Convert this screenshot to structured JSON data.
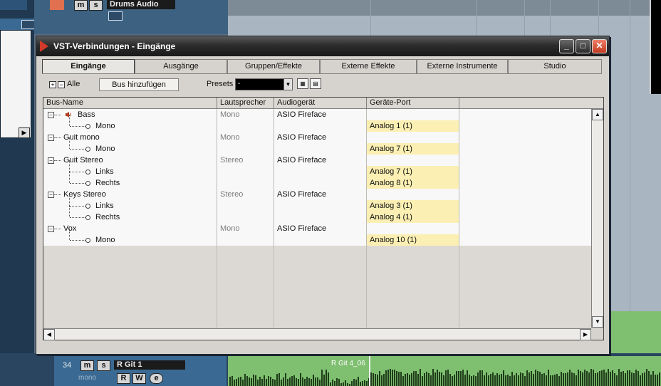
{
  "window": {
    "title": "VST-Verbindungen - Eingänge",
    "minimize_label": "_",
    "maximize_label": "□",
    "close_label": "✕"
  },
  "tabs": [
    {
      "label": "Eingänge",
      "active": true
    },
    {
      "label": "Ausgänge"
    },
    {
      "label": "Gruppen/Effekte"
    },
    {
      "label": "Externe Effekte"
    },
    {
      "label": "Externe Instrumente"
    },
    {
      "label": "Studio"
    }
  ],
  "toolbar": {
    "all_label": "Alle",
    "add_bus_label": "Bus hinzufügen",
    "presets_label": "Presets",
    "presets_value": "-"
  },
  "table": {
    "columns": [
      "Bus-Name",
      "Lautsprecher",
      "Audiogerät",
      "Geräte-Port"
    ],
    "rows": [
      {
        "name": "Bass",
        "speaker": "Mono",
        "device": "ASIO Fireface",
        "port": "",
        "level": 0
      },
      {
        "name": "Mono",
        "speaker": "",
        "device": "",
        "port": "Analog 1 (1)",
        "level": 1
      },
      {
        "name": "Guit mono",
        "speaker": "Mono",
        "device": "ASIO Fireface",
        "port": "",
        "level": 0
      },
      {
        "name": "Mono",
        "speaker": "",
        "device": "",
        "port": "Analog 7 (1)",
        "level": 1
      },
      {
        "name": "Guit Stereo",
        "speaker": "Stereo",
        "device": "ASIO Fireface",
        "port": "",
        "level": 0
      },
      {
        "name": "Links",
        "speaker": "",
        "device": "",
        "port": "Analog 7 (1)",
        "level": 1
      },
      {
        "name": "Rechts",
        "speaker": "",
        "device": "",
        "port": "Analog 8 (1)",
        "level": 1
      },
      {
        "name": "Keys Stereo",
        "speaker": "Stereo",
        "device": "ASIO Fireface",
        "port": "",
        "level": 0
      },
      {
        "name": "Links",
        "speaker": "",
        "device": "",
        "port": "Analog 3 (1)",
        "level": 1
      },
      {
        "name": "Rechts",
        "speaker": "",
        "device": "",
        "port": "Analog 4 (1)",
        "level": 1
      },
      {
        "name": "Vox",
        "speaker": "Mono",
        "device": "ASIO Fireface",
        "port": "",
        "level": 0
      },
      {
        "name": "Mono",
        "speaker": "",
        "device": "",
        "port": "Analog 10 (1)",
        "level": 1
      }
    ]
  },
  "background": {
    "top_track_name": "Drums Audio",
    "bottom_track_number": "34",
    "bottom_track_name": "R Git 1",
    "bottom_track_mode": "mono",
    "part_label": "R Git 4_06",
    "mute_label": "m",
    "solo_label": "s",
    "read_label": "R",
    "write_label": "W",
    "edit_label": "e"
  },
  "colors": {
    "port_highlight": "#fbefb3",
    "close_button": "#d84a30",
    "audio_part": "#7fbf70"
  }
}
